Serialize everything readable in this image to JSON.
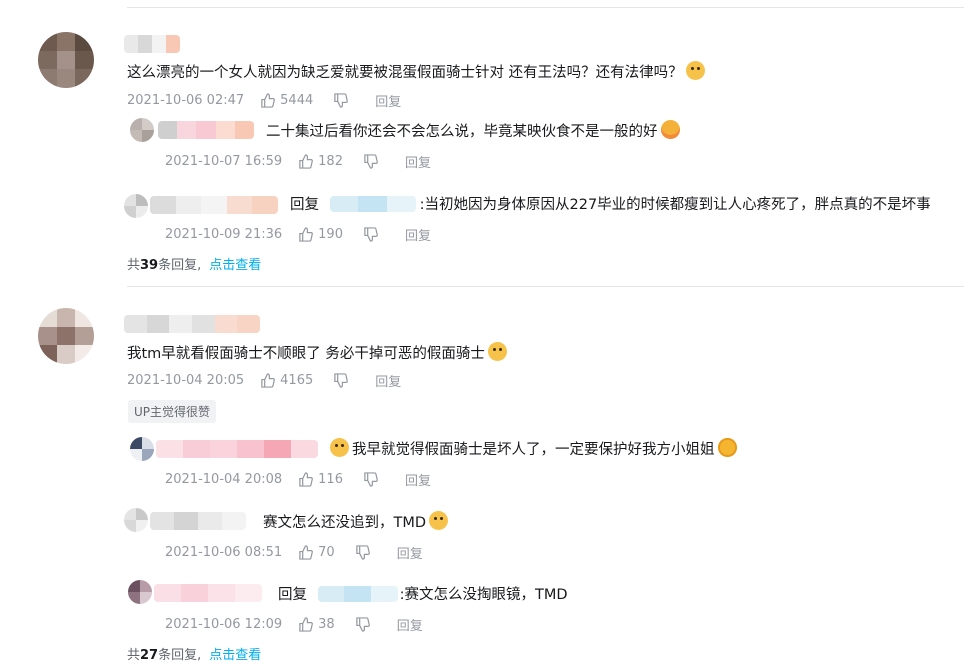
{
  "threads": [
    {
      "text": "这么漂亮的一个女人就因为缺乏爱就要被混蛋假面骑士针对 还有王法吗？还有法律吗？",
      "time": "2021-10-06 02:47",
      "likes": "5444",
      "reply_label": "回复",
      "sub_replies": [
        {
          "text": "二十集过后看你还会不会怎么说，毕竟某映伙食不是一般的好",
          "time": "2021-10-07 16:59",
          "likes": "182",
          "reply_label": "回复"
        },
        {
          "prefix": "回复",
          "text": ":当初她因为身体原因从227毕业的时候都瘦到让人心疼死了，胖点真的不是坏事",
          "time": "2021-10-09 21:36",
          "likes": "190",
          "reply_label": "回复"
        }
      ],
      "total_pre": "共",
      "total_count": "39",
      "total_post": "条回复,",
      "expand_link": "点击查看"
    },
    {
      "text": "我tm早就看假面骑士不顺眼了  务必干掉可恶的假面骑士",
      "time": "2021-10-04 20:05",
      "likes": "4165",
      "reply_label": "回复",
      "up_badge": "UP主觉得很赞",
      "sub_replies": [
        {
          "text": "我早就觉得假面骑士是坏人了，一定要保护好我方小姐姐",
          "time": "2021-10-04 20:08",
          "likes": "116",
          "reply_label": "回复"
        },
        {
          "text": "赛文怎么还没追到，TMD",
          "time": "2021-10-06 08:51",
          "likes": "70",
          "reply_label": "回复"
        },
        {
          "prefix": "回复",
          "text": ":赛文怎么没掏眼镜，TMD",
          "time": "2021-10-06 12:09",
          "likes": "38",
          "reply_label": "回复"
        }
      ],
      "total_pre": "共",
      "total_count": "27",
      "total_post": "条回复,",
      "expand_link": "点击查看"
    }
  ],
  "colors": {
    "link": "#00aeec",
    "meta": "#9499a0",
    "text": "#18191c"
  }
}
